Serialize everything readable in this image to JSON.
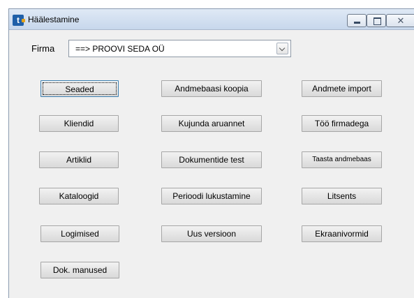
{
  "window": {
    "title": "Häälestamine",
    "close_glyph": "✕"
  },
  "firma": {
    "label": "Firma",
    "value": "==> PROOVI SEDA OÜ"
  },
  "buttons": {
    "seaded": "Seaded",
    "andmebaasi_koopia": "Andmebaasi koopia",
    "andmete_import": "Andmete import",
    "kliendid": "Kliendid",
    "kujunda_aruannet": "Kujunda aruannet",
    "too_firmadega": "Töö firmadega",
    "artiklid": "Artiklid",
    "dokumentide_test": "Dokumentide test",
    "taasta_andmebaas": "Taasta andmebaas",
    "kataloogid": "Kataloogid",
    "perioodi_lukustamine": "Perioodi lukustamine",
    "litsents": "Litsents",
    "logimised": "Logimised",
    "uus_versioon": "Uus versioon",
    "ekraanivormid": "Ekraanivormid",
    "dok_manused": "Dok. manused"
  }
}
